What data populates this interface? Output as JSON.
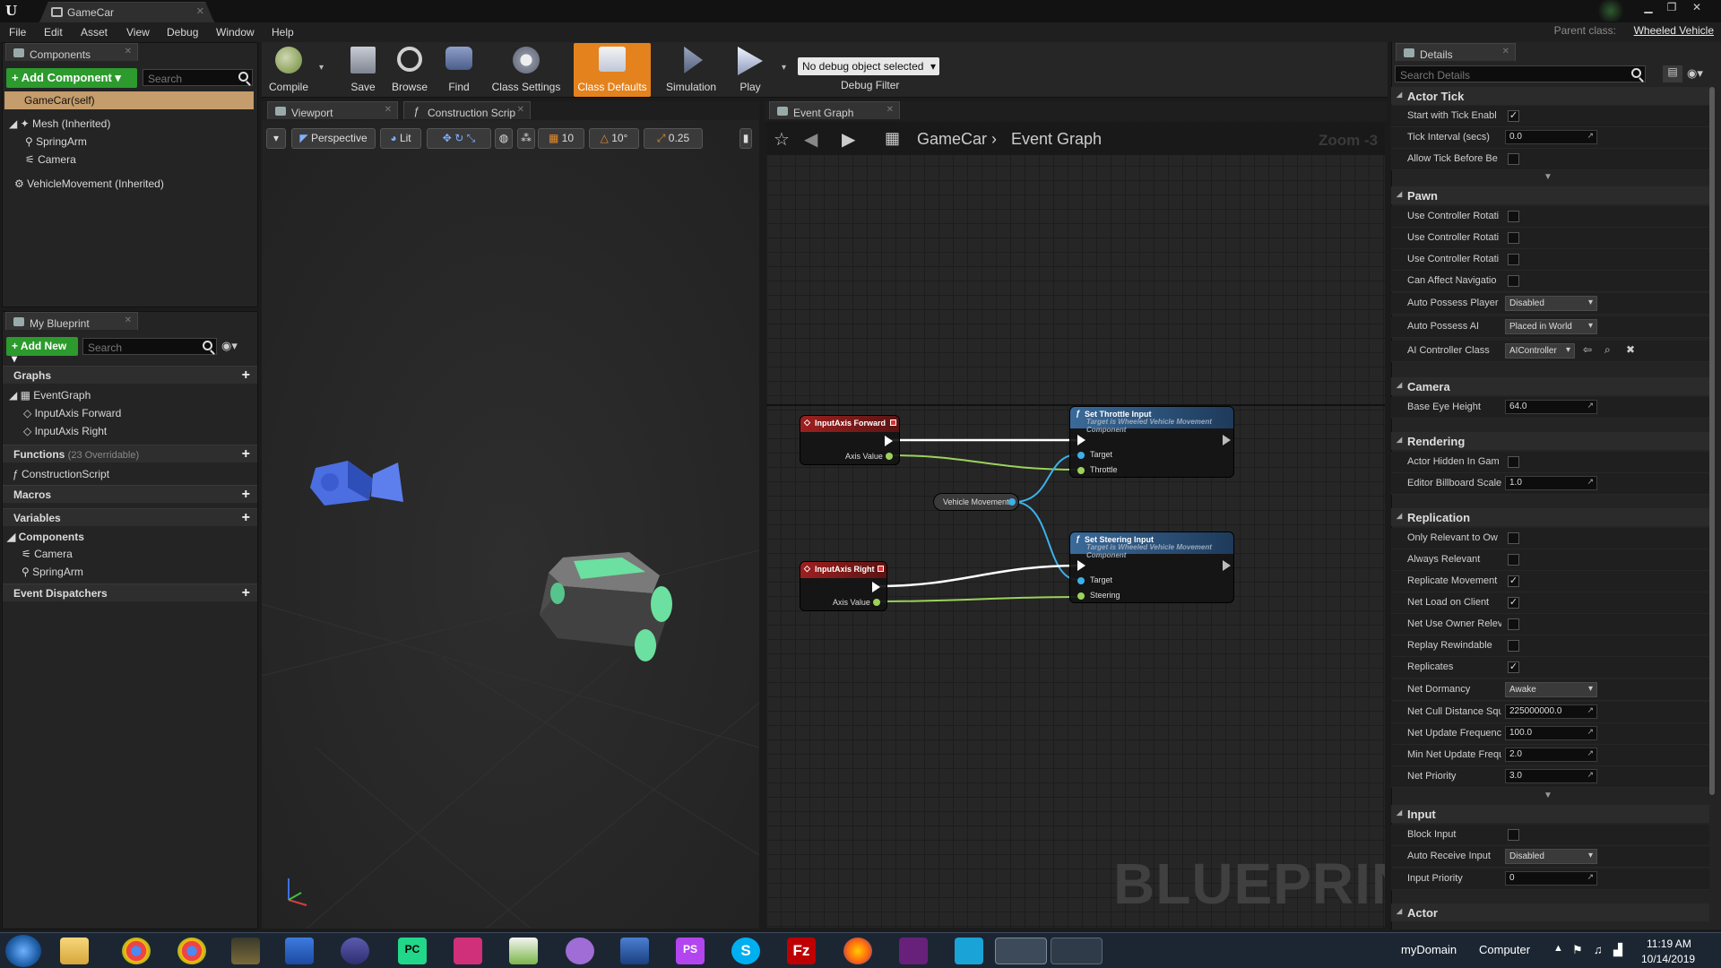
{
  "window": {
    "tab_title": "GameCar",
    "parent_class_label": "Parent class:",
    "parent_class_value": "Wheeled Vehicle"
  },
  "menu": [
    "File",
    "Edit",
    "Asset",
    "View",
    "Debug",
    "Window",
    "Help"
  ],
  "components_panel": {
    "tab": "Components",
    "add_button": "+ Add Component ▾",
    "search_placeholder": "Search",
    "items": [
      "GameCar(self)",
      "Mesh (Inherited)",
      "SpringArm",
      "Camera",
      "VehicleMovement (Inherited)"
    ]
  },
  "my_blueprint": {
    "tab": "My Blueprint",
    "add_button": "+ Add New ▾",
    "search_placeholder": "Search",
    "graphs_header": "Graphs",
    "graphs": [
      "EventGraph",
      "InputAxis Forward",
      "InputAxis Right"
    ],
    "functions_header": "Functions",
    "functions_count": "(23 Overridable)",
    "functions": [
      "ConstructionScript"
    ],
    "macros_header": "Macros",
    "variables_header": "Variables",
    "components_header": "Components",
    "components": [
      "Camera",
      "SpringArm"
    ],
    "dispatchers_header": "Event Dispatchers"
  },
  "toolbar": {
    "compile": "Compile",
    "save": "Save",
    "browse": "Browse",
    "find": "Find",
    "class_settings": "Class Settings",
    "class_defaults": "Class Defaults",
    "simulation": "Simulation",
    "play": "Play",
    "debug_select": "No debug object selected",
    "debug_filter": "Debug Filter"
  },
  "tabs": {
    "viewport": "Viewport",
    "construction": "Construction Scrip",
    "event_graph": "Event Graph"
  },
  "viewport_toolbar": {
    "perspective": "Perspective",
    "lit": "Lit",
    "grid": "10",
    "rotation": "10°",
    "scale": "0.25"
  },
  "graph": {
    "breadcrumb_root": "GameCar",
    "breadcrumb_leaf": "Event Graph",
    "zoom": "Zoom -3",
    "watermark": "BLUEPRINT",
    "nodes": {
      "forward": {
        "title": "InputAxis Forward",
        "pin": "Axis Value"
      },
      "right": {
        "title": "InputAxis Right",
        "pin": "Axis Value"
      },
      "throttle": {
        "title": "Set Throttle Input",
        "subtitle": "Target is Wheeled Vehicle Movement Component",
        "pin1": "Target",
        "pin2": "Throttle"
      },
      "steering": {
        "title": "Set Steering Input",
        "subtitle": "Target is Wheeled Vehicle Movement Component",
        "pin1": "Target",
        "pin2": "Steering"
      },
      "vehicle_movement": {
        "title": "Vehicle Movement"
      }
    }
  },
  "details": {
    "tab": "Details",
    "search_placeholder": "Search Details",
    "sections": {
      "actor_tick": "Actor Tick",
      "pawn": "Pawn",
      "camera": "Camera",
      "rendering": "Rendering",
      "replication": "Replication",
      "input": "Input",
      "actor": "Actor"
    },
    "rows": {
      "start_tick": "Start with Tick Enabl",
      "tick_interval": "Tick Interval (secs)",
      "tick_interval_val": "0.0",
      "allow_tick": "Allow Tick Before Be",
      "ucr1": "Use Controller Rotati",
      "ucr2": "Use Controller Rotati",
      "ucr3": "Use Controller Rotati",
      "can_affect": "Can Affect Navigatio",
      "auto_possess_player": "Auto Possess Player",
      "auto_possess_player_val": "Disabled",
      "auto_possess_ai": "Auto Possess AI",
      "auto_possess_ai_val": "Placed in World",
      "ai_controller": "AI Controller Class",
      "ai_controller_val": "AIController",
      "eye_height": "Base Eye Height",
      "eye_height_val": "64.0",
      "hidden_in_game": "Actor Hidden In Gam",
      "billboard_scale": "Editor Billboard Scale",
      "billboard_scale_val": "1.0",
      "only_relevant": "Only Relevant to Ow",
      "always_relevant": "Always Relevant",
      "replicate_movement": "Replicate Movement",
      "net_load": "Net Load on Client",
      "net_use_owner": "Net Use Owner Relev",
      "replay_rewindable": "Replay Rewindable",
      "replicates": "Replicates",
      "net_dormancy": "Net Dormancy",
      "net_dormancy_val": "Awake",
      "net_cull": "Net Cull Distance Squ",
      "net_cull_val": "225000000.0",
      "net_update_freq": "Net Update Frequenc",
      "net_update_freq_val": "100.0",
      "min_net_update": "Min Net Update Frequ",
      "min_net_update_val": "2.0",
      "net_priority": "Net Priority",
      "net_priority_val": "3.0",
      "block_input": "Block Input",
      "auto_receive": "Auto Receive Input",
      "auto_receive_val": "Disabled",
      "input_priority": "Input Priority",
      "input_priority_val": "0"
    }
  },
  "taskbar": {
    "domain": "myDomain",
    "computer": "Computer",
    "time": "11:19 AM",
    "date": "10/14/2019"
  }
}
